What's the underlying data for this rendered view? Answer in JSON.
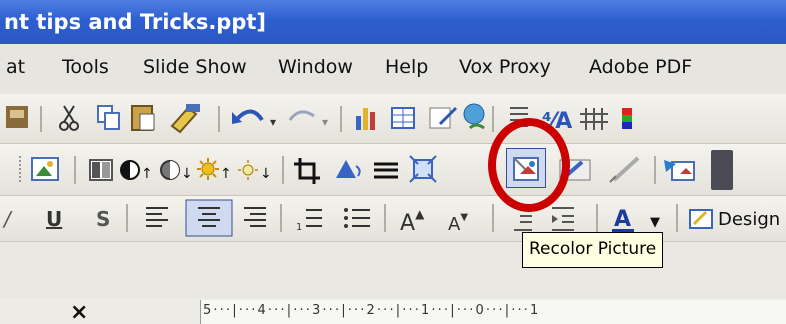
{
  "window": {
    "title": "nt tips and Tricks.ppt]"
  },
  "menu": [
    {
      "label": "at"
    },
    {
      "label": "Tools"
    },
    {
      "label": "Slide Show"
    },
    {
      "label": "Window"
    },
    {
      "label": "Help"
    },
    {
      "label": "Vox Proxy"
    },
    {
      "label": "Adobe PDF"
    }
  ],
  "toolbar_format": {
    "design_label": "Design"
  },
  "tooltip": {
    "text": "Recolor Picture"
  },
  "ruler": {
    "text": "5 · · · | · · · 4 · · · | · · · 3 · · · | · · · 2 · · · | · · · 1 · · · | · · · 0 · · · | · · · 1"
  },
  "pane": {
    "close_symbol": "×"
  },
  "colors": {
    "titlebar": "#2e5fcf",
    "highlight_circle": "#cc0000",
    "tooltip_bg": "#ffffe1"
  }
}
